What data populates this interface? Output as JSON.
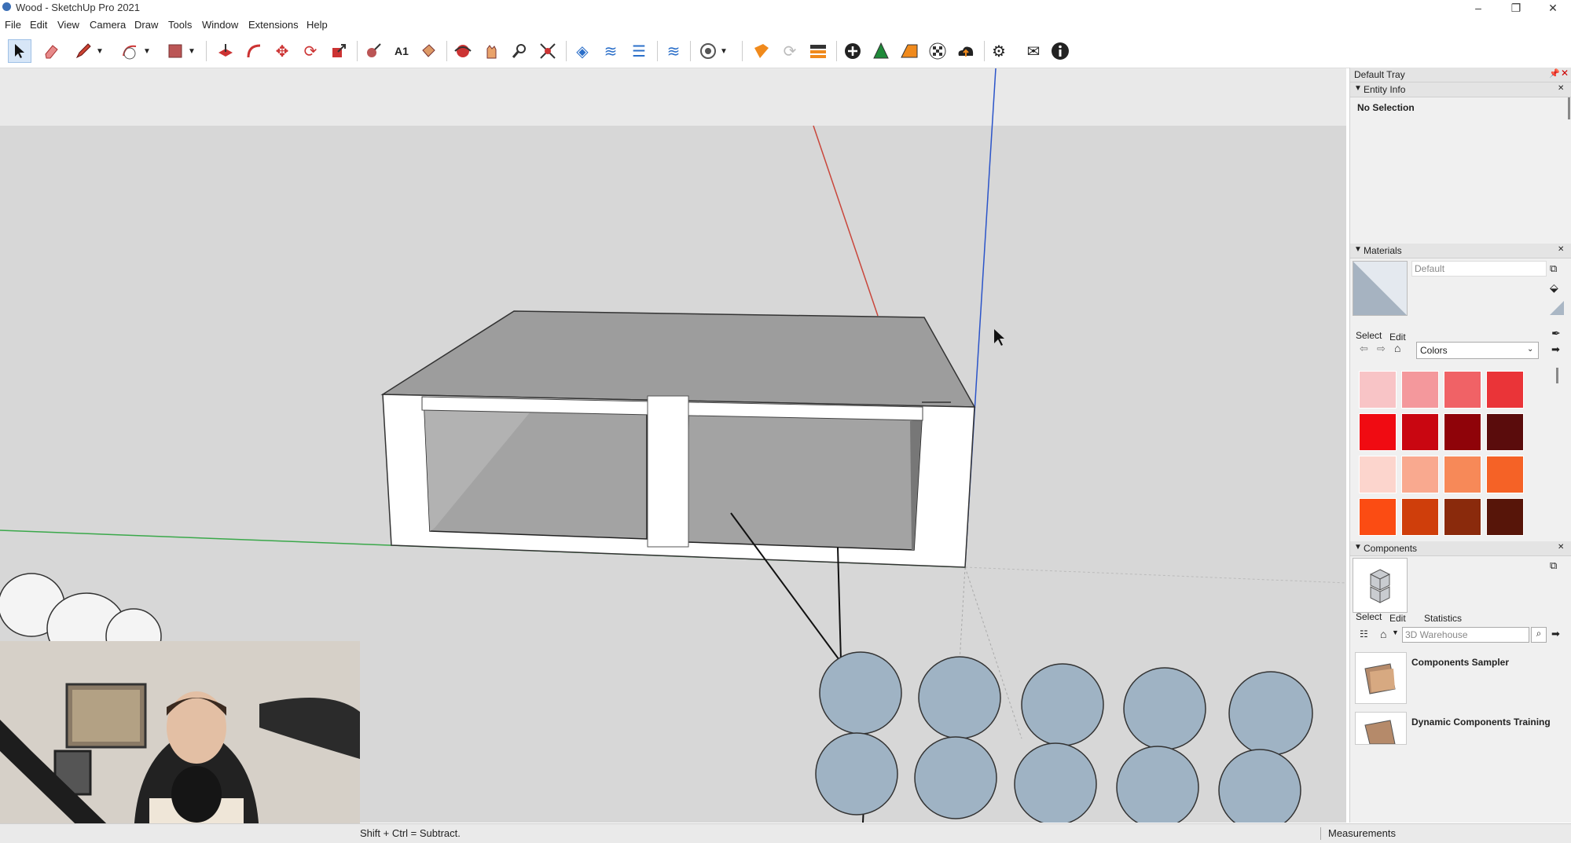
{
  "window": {
    "title": "Wood - SketchUp Pro 2021",
    "minimize": "–",
    "maximize": "❐",
    "close": "✕"
  },
  "menu": [
    "File",
    "Edit",
    "View",
    "Camera",
    "Draw",
    "Tools",
    "Window",
    "Extensions",
    "Help"
  ],
  "toolbar": {
    "icons": [
      "select-icon",
      "eraser-icon",
      "pencil-line-icon",
      "chevron-down-icon",
      "arc-icon",
      "chevron-down-icon",
      "rectangle-icon",
      "chevron-down-icon",
      "push-pull-icon",
      "follow-me-icon",
      "move-icon",
      "rotate-icon",
      "scale-icon",
      "tape-measure-icon",
      "text-icon",
      "paint-bucket-icon",
      "orbit-icon",
      "pan-icon",
      "zoom-icon",
      "zoom-extents-icon",
      "section-plane-icon",
      "section-display-icon",
      "tags-icon",
      "solid-tools-icon",
      "sandbox-icon",
      "chevron-down-icon",
      "layout-icon",
      "refresh-icon",
      "scenes-icon",
      "add-location-icon",
      "trees-icon",
      "photo-match-icon",
      "texture-icon",
      "cloud-upload-icon",
      "settings-icon",
      "mail-icon",
      "info-icon"
    ]
  },
  "tray": {
    "title": "Default Tray",
    "entity_info": {
      "header": "Entity Info",
      "selection": "No Selection"
    },
    "materials": {
      "header": "Materials",
      "current_name": "Default",
      "tab_select": "Select",
      "tab_edit": "Edit",
      "library": "Colors",
      "swatches": [
        "#f8c4c6",
        "#f4989c",
        "#f06266",
        "#ea3438",
        "#f00b12",
        "#c90611",
        "#8f0309",
        "#5a0c0c",
        "#fcd5cd",
        "#f9a98f",
        "#f78958",
        "#f56226",
        "#fb4c13",
        "#cf3e0b",
        "#8a2a0c",
        "#571509",
        "#fde2cc",
        "#fbc994",
        "#f8b364",
        "#f49b2d",
        "#f87c16",
        "#d96a10",
        "#9d4c0b",
        "#5d2b06"
      ]
    },
    "components": {
      "header": "Components",
      "tab_select": "Select",
      "tab_edit": "Edit",
      "tab_statistics": "Statistics",
      "search_placeholder": "3D Warehouse",
      "items": [
        "Components Sampler",
        "Dynamic Components Training"
      ]
    }
  },
  "status": {
    "hint": "Shift + Ctrl = Subtract.",
    "measurements_label": "Measurements"
  },
  "colors": {
    "axis_red": "#c9463b",
    "axis_blue": "#2b54c9",
    "axis_green": "#3aa84a",
    "selection_blue": "#d7e6f7"
  }
}
